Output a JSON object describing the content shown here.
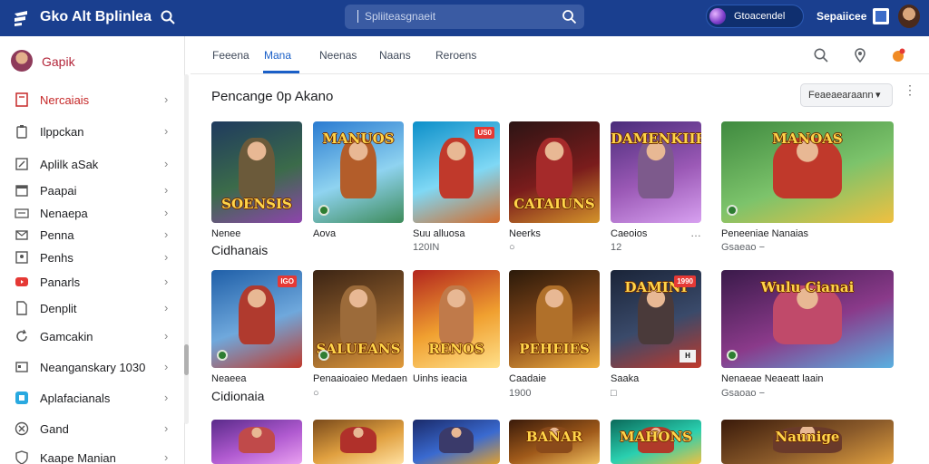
{
  "header": {
    "app_title": "Gko Alt Bplinlea",
    "search_placeholder": "Spliiteasgnaeit",
    "chip_label": "Gtoacendel",
    "right_label": "Sepaiicee"
  },
  "sidebar": {
    "profile_name": "Gapik",
    "items": [
      {
        "label": "Nercaiais",
        "icon": "document-icon",
        "active": true
      },
      {
        "label": "Ilppckan",
        "icon": "clipboard-icon"
      },
      {
        "label": "Aplilk aSak",
        "icon": "edit-icon"
      },
      {
        "label": "Paapai",
        "icon": "calendar-icon"
      },
      {
        "label": "Nenaepa",
        "icon": "keyboard-icon"
      },
      {
        "label": "Penna",
        "icon": "mail-icon"
      },
      {
        "label": "Penhs",
        "icon": "person-icon"
      },
      {
        "label": "Panarls",
        "icon": "youtube-icon"
      },
      {
        "label": "Denplit",
        "icon": "file-icon"
      },
      {
        "label": "Gamcakin",
        "icon": "refresh-icon"
      },
      {
        "label": "Neanganskary 1030",
        "icon": "window-icon"
      },
      {
        "label": "Aplafacianals",
        "icon": "app-icon"
      },
      {
        "label": "Gand",
        "icon": "close-circle-icon"
      },
      {
        "label": "Kaape Manian",
        "icon": "shield-icon"
      }
    ]
  },
  "tabs": [
    "Feeena",
    "Mana",
    "Neenas",
    "Naans",
    "Reroens"
  ],
  "section": {
    "title": "Pencange 0p Akano",
    "sort_label": "Feaeaearaann",
    "more_label": "⋮"
  },
  "cards_row1": [
    {
      "title": "SOENSIS",
      "name": "Nenee",
      "sub": "Cidhanais",
      "colors": [
        "#1f3a5e",
        "#3b6b4a",
        "#8e44ad"
      ],
      "figure": "#6b5a3a",
      "title_pos": "bottom"
    },
    {
      "title": "MANUOS",
      "name": "Aova",
      "sub": "",
      "colors": [
        "#2a7bd1",
        "#8fd3f0",
        "#3d8b5a"
      ],
      "figure": "#b35d2a",
      "title_pos": "top"
    },
    {
      "title": "",
      "name": "Suu alluosa",
      "sub": "120IN",
      "colors": [
        "#0c8fc9",
        "#7fd8f5",
        "#d36b2a"
      ],
      "figure": "#c0392b",
      "badge": "US0"
    },
    {
      "title": "CATAIUNS",
      "name": "Neerks",
      "sub": "○",
      "colors": [
        "#2b1414",
        "#7a1c1c",
        "#d4942a"
      ],
      "figure": "#a52a2a",
      "title_pos": "bottom"
    },
    {
      "title": "DAMENKIIE",
      "name": "Caeoios",
      "sub": "12",
      "colors": [
        "#4a2c7a",
        "#9b59b6",
        "#d7a0f0"
      ],
      "figure": "#7d5a8c",
      "title_pos": "top"
    },
    {
      "title": "MANOAS",
      "name": "Peneeniae Nanaias",
      "sub": "Gsaeao −",
      "colors": [
        "#3f8a3f",
        "#7cc36b",
        "#f0c040"
      ],
      "figure": "#c0392b",
      "title_pos": "top"
    }
  ],
  "cards_row2": [
    {
      "title": "",
      "name": "Neaeea",
      "sub": "Cidionaia",
      "colors": [
        "#1f5fa8",
        "#6fa8dc",
        "#c0392b"
      ],
      "figure": "#b03a2e",
      "badge": "IGO"
    },
    {
      "title": "SALUEANS",
      "name": "Penaaioaieo Medaen",
      "sub": "○",
      "colors": [
        "#3b2414",
        "#8a5a2a",
        "#e09a3a"
      ],
      "figure": "#9c6b3a",
      "title_pos": "bottom"
    },
    {
      "title": "RENOS",
      "name": "Uinhs ieacia",
      "sub": "",
      "colors": [
        "#b3261e",
        "#f0a030",
        "#ffe08a"
      ],
      "figure": "#c07a4a",
      "title_pos": "bottom"
    },
    {
      "title": "PEHEIES",
      "name": "Caadaie",
      "sub": "1900",
      "colors": [
        "#2b1a0a",
        "#8a4a1a",
        "#f0b040"
      ],
      "figure": "#b0702a",
      "title_pos": "bottom"
    },
    {
      "title": "DAMINI",
      "name": "Saaka",
      "sub": "□",
      "colors": [
        "#1a2438",
        "#3a4a6a",
        "#c0392b"
      ],
      "figure": "#4a3a3a",
      "badge": "1990",
      "title_pos": "top"
    },
    {
      "title": "Wulu Cianai",
      "name": "Nenaeae Neaeatt laain",
      "sub": "Gsaoao −",
      "colors": [
        "#3a1a4a",
        "#8a3a8a",
        "#5ab0e0"
      ],
      "figure": "#c04a6a",
      "title_pos": "top"
    }
  ],
  "cards_row3": [
    {
      "title": "",
      "colors": [
        "#5a2a8a",
        "#b05ad0",
        "#e9a0f0"
      ],
      "figure": "#c04a4a"
    },
    {
      "title": "",
      "colors": [
        "#7a4a1a",
        "#e0a040",
        "#ffe0a0"
      ],
      "figure": "#b0302a"
    },
    {
      "title": "",
      "colors": [
        "#1a2a6a",
        "#3a6ad0",
        "#e0a030"
      ],
      "figure": "#3a3a6a"
    },
    {
      "title": "BANAR",
      "colors": [
        "#3a1a0a",
        "#a05a1a",
        "#f0c060"
      ],
      "figure": "#8a4a1a",
      "title_pos": "top"
    },
    {
      "title": "MAHONS",
      "colors": [
        "#0a6a5a",
        "#2ad0b0",
        "#f0c040"
      ],
      "figure": "#b03a2a",
      "title_pos": "top"
    },
    {
      "title": "Naunige",
      "colors": [
        "#3a1a0a",
        "#8a5a2a",
        "#e0a040"
      ],
      "figure": "#6a3a2a",
      "title_pos": "top"
    }
  ]
}
